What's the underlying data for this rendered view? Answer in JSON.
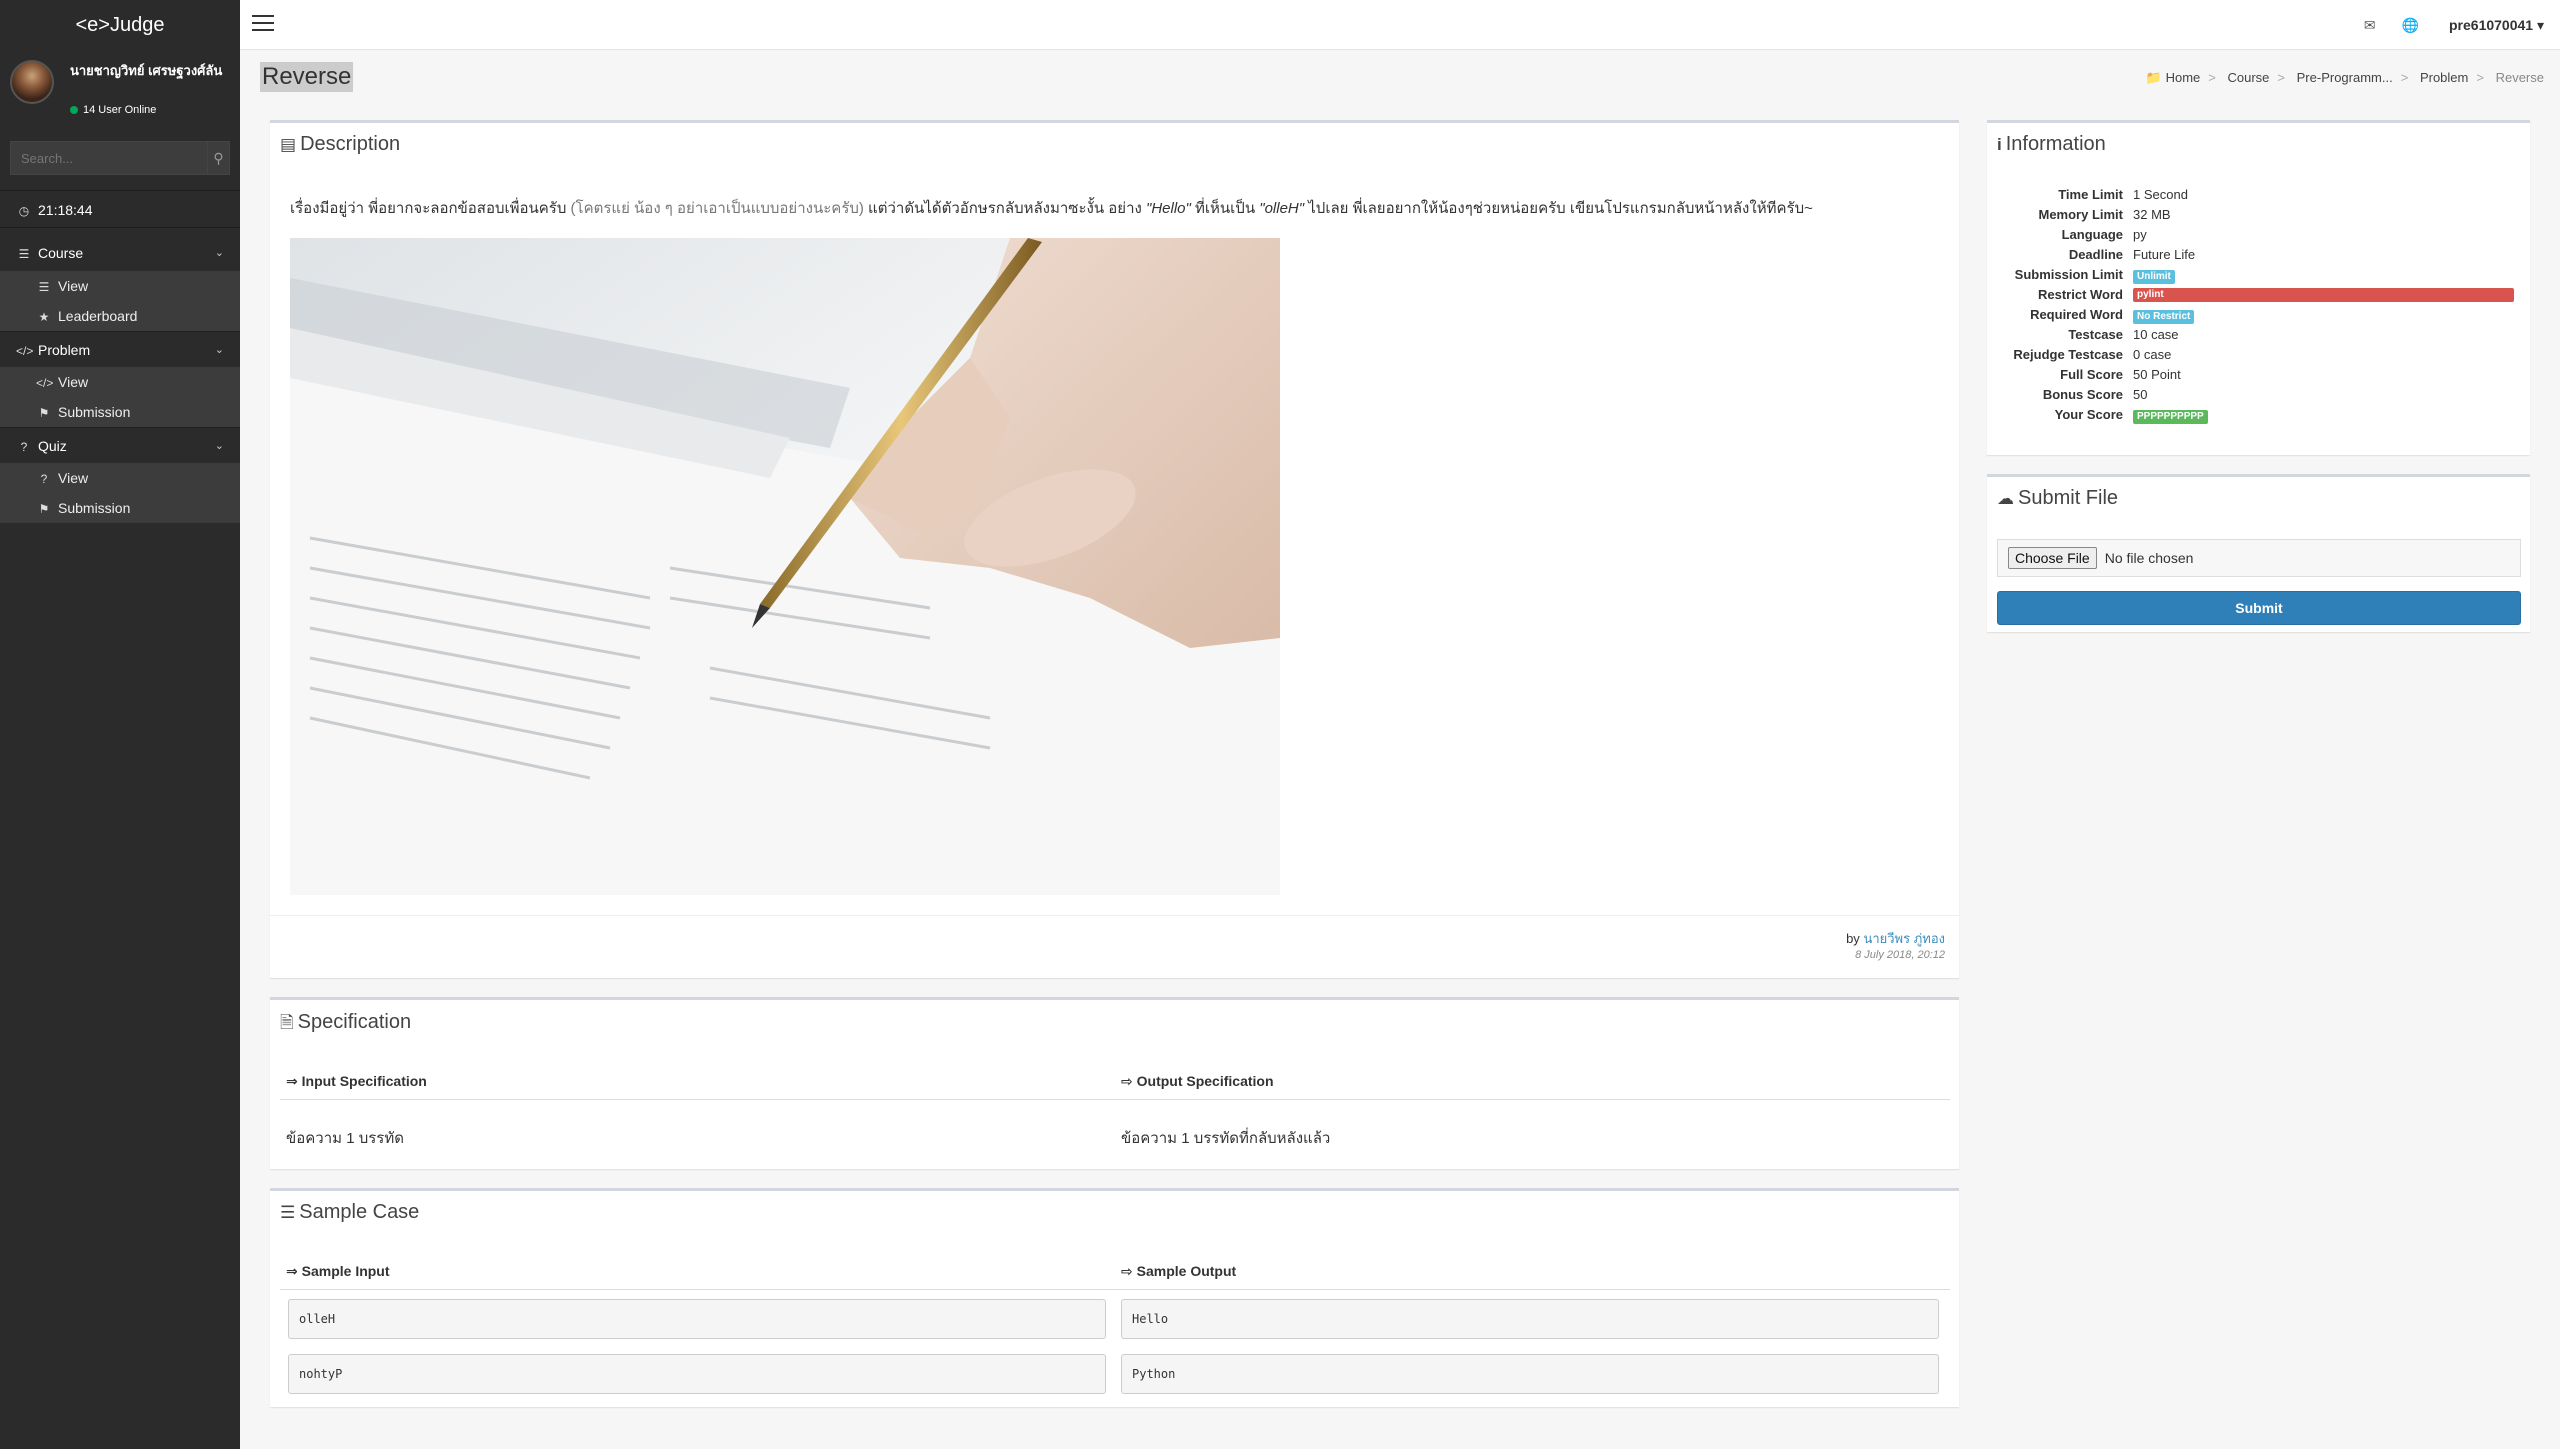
{
  "app": {
    "brand": "<e>Judge"
  },
  "sidebar": {
    "user_name": "นายชาญวิทย์ เศรษฐวงศ์ลัน",
    "online": "14 User Online",
    "search_placeholder": "Search...",
    "clock": "21:18:44",
    "menus": [
      {
        "label": "Course",
        "items": [
          "View",
          "Leaderboard"
        ]
      },
      {
        "label": "Problem",
        "items": [
          "View",
          "Submission"
        ]
      },
      {
        "label": "Quiz",
        "items": [
          "View",
          "Submission"
        ]
      }
    ]
  },
  "topbar": {
    "username": "pre61070041"
  },
  "page": {
    "title": "Reverse",
    "breadcrumb": [
      "Home",
      "Course",
      "Pre-Programm...",
      "Problem",
      "Reverse"
    ]
  },
  "description": {
    "heading": "Description",
    "text_a": "เรื่องมีอยู่ว่า พี่อยากจะลอกข้อสอบเพื่อนครับ ",
    "text_b": "(โคตรแย่ น้อง ๆ อย่าเอาเป็นแบบอย่างนะครับ)",
    "text_c": " แต่ว่าดันได้ตัวอักษรกลับหลังมาซะงั้น อย่าง ",
    "text_d": "\"Hello\"",
    "text_e": " ที่เห็นเป็น ",
    "text_f": "\"olleH\"",
    "text_g": " ไปเลย พี่เลยอยากให้น้องๆช่วยหน่อยครับ เขียนโปรแกรมกลับหน้าหลังให้ทีครับ~",
    "by": "by",
    "author": "นายวีพร ภู่ทอง",
    "date": "8 July 2018, 20:12"
  },
  "specification": {
    "heading": "Specification",
    "input_head": "Input Specification",
    "output_head": "Output Specification",
    "input_val": "ข้อความ 1 บรรทัด",
    "output_val": "ข้อความ 1 บรรทัดที่กลับหลังแล้ว"
  },
  "sample": {
    "heading": "Sample Case",
    "input_head": "Sample Input",
    "output_head": "Sample Output",
    "cases": [
      {
        "input": "olleH",
        "output": "Hello"
      },
      {
        "input": "nohtyP",
        "output": "Python"
      }
    ]
  },
  "information": {
    "heading": "Information",
    "rows": [
      {
        "k": "Time Limit",
        "v": "1 Second"
      },
      {
        "k": "Memory Limit",
        "v": "32 MB"
      },
      {
        "k": "Language",
        "v": "py"
      },
      {
        "k": "Deadline",
        "v": "Future Life"
      },
      {
        "k": "Submission Limit",
        "v": "Unlimit"
      },
      {
        "k": "Restrict Word",
        "v": "pylint"
      },
      {
        "k": "Required Word",
        "v": "No Restrict"
      },
      {
        "k": "Testcase",
        "v": "10 case"
      },
      {
        "k": "Rejudge Testcase",
        "v": "0 case"
      },
      {
        "k": "Full Score",
        "v": "50 Point"
      },
      {
        "k": "Bonus Score",
        "v": "50"
      },
      {
        "k": "Your Score",
        "v": "PPPPPPPPPP"
      }
    ]
  },
  "submit": {
    "heading": "Submit File",
    "choose": "Choose File",
    "no_file": "No file chosen",
    "button": "Submit"
  },
  "colors": {
    "primary": "#2f7fb8",
    "info": "#5bc0de",
    "danger": "#d9534f",
    "success": "#5cb85c",
    "sidebar": "#2b2b2b"
  }
}
